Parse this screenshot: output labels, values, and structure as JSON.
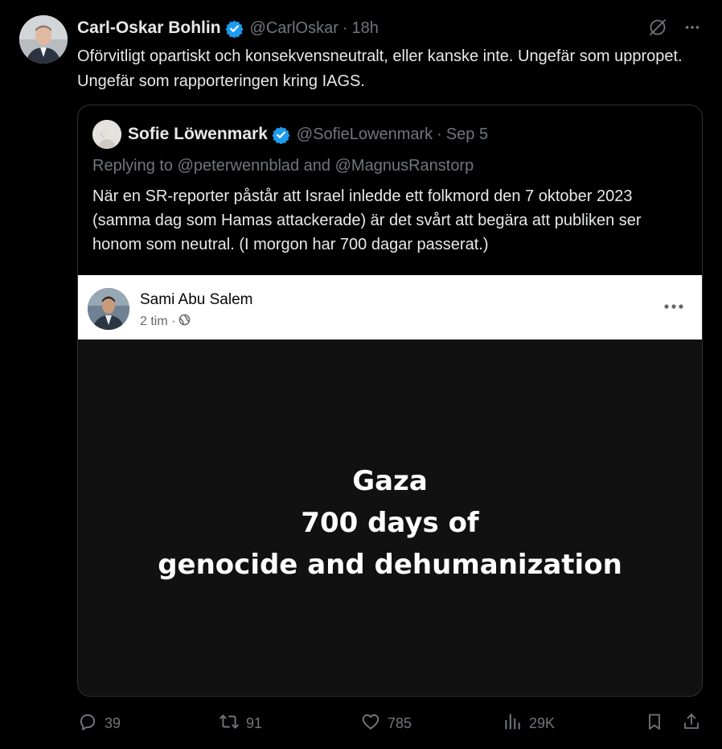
{
  "author": {
    "name": "Carl-Oskar Bohlin",
    "handle": "@CarlOskar",
    "separator": "·",
    "time": "18h",
    "verified_color": "#1d9bf0"
  },
  "tweet": {
    "text": "Oförvitligt opartiskt och konsekvensneutralt, eller kanske inte. Ungefär som uppropet. Ungefär som rapporteringen kring IAGS."
  },
  "header_icons": [
    "grok-icon",
    "more-icon"
  ],
  "quote": {
    "name": "Sofie Löwenmark",
    "handle": "@SofieLowenmark",
    "separator": "·",
    "time": "Sep 5",
    "replying": "Replying to @peterwennblad and @MagnusRanstorp",
    "text": "När en SR-reporter påstår att Israel inledde ett folkmord den 7 oktober 2023 (samma dag som Hamas attackerade) är det svårt att begära att publiken ser honom som neutral. (I morgon har 700 dagar passerat.)",
    "media": {
      "fb_name": "Sami Abu Salem",
      "fb_time": "2 tim ·",
      "line1": "Gaza",
      "line2": "700 days of",
      "line3": "genocide and dehumanization"
    }
  },
  "actions": {
    "replies": "39",
    "reposts": "91",
    "likes": "785",
    "views": "29K"
  },
  "colors": {
    "background": "#000000",
    "text": "#e7e9ea",
    "muted": "#71767b",
    "border": "#2f3336",
    "accent": "#1d9bf0"
  }
}
